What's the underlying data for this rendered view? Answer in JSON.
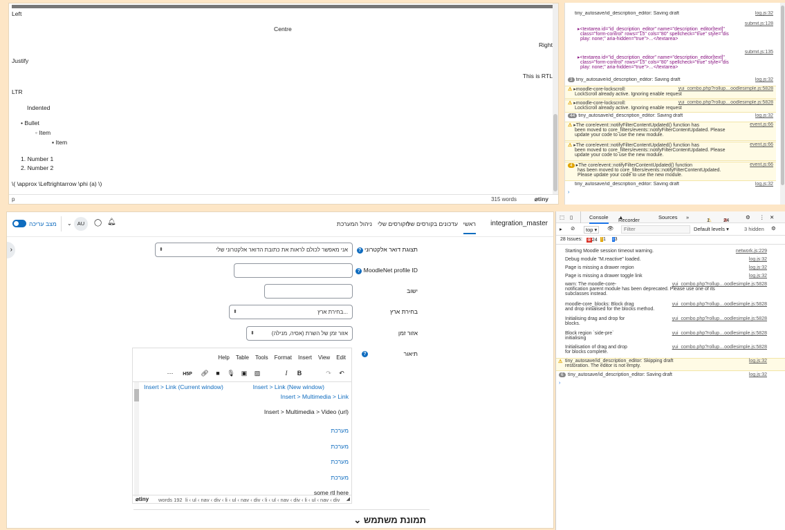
{
  "top_editor": {
    "lines": [
      "Left",
      "Centre",
      "Right",
      "Justify",
      "This is RTL",
      "LTR",
      "Indented",
      "Bullet",
      "Item",
      "Item",
      "Number 1",
      "Number 2",
      "\\( \\approx \\Leftrightarrow \\phi (a) \\)"
    ],
    "status_path": "p",
    "word_count": "315 words",
    "brand": "tiny"
  },
  "top_console": [
    {
      "msg": "tiny_autosave/id_description_editor: Saving draft",
      "src": "log.js:32"
    },
    {
      "msg": "<textarea id=\"id_description_editor\" name=\"description_editor[text]\"",
      "msg2": "class=\"form-control\" rows=\"15\" cols=\"80\" spellcheck=\"true\" style=\"dis",
      "msg3": "play: none;\" aria-hidden=\"true\">…</textarea>",
      "src": "submit.js:128"
    },
    {
      "msg": "<textarea id=\"id_description_editor\" name=\"description_editor[text]\"",
      "msg2": "class=\"form-control\" rows=\"15\" cols=\"80\" spellcheck=\"true\" style=\"dis",
      "msg3": "play: none;\" aria-hidden=\"true\">…</textarea>",
      "src": "submit.js:135"
    },
    {
      "count": "3",
      "msg": "tiny_autosave/id_description_editor: Saving draft",
      "src": "log.js:32"
    },
    {
      "msg": "moodle-core-lockscroll:",
      "msg2": "LockScroll already active. Ignoring enable request",
      "src": "yui_combo.php?rollup…oodlesimple.js:5828"
    },
    {
      "msg": "moodle-core-lockscroll:",
      "msg2": "LockScroll already active. Ignoring enable request",
      "src": "yui_combo.php?rollup…oodlesimple.js:5828"
    },
    {
      "count": "44",
      "msg": "tiny_autosave/id_description_editor: Saving draft",
      "src": "log.js:32"
    },
    {
      "msg": "The core/event::notifyFilterContentUpdated() function has",
      "msg2": "been moved to core_filters/events::notifyFilterContentUpdated. Please",
      "msg3": "update your code to use the new module.",
      "src": "event.js:66"
    },
    {
      "msg": "The core/event::notifyFilterContentUpdated() function has",
      "msg2": "been moved to core_filters/events::notifyFilterContentUpdated. Please",
      "msg3": "update your code to use the new module.",
      "src": "event.js:66"
    },
    {
      "count": "4",
      "msg": "The core/event::notifyFilterContentUpdated() function",
      "msg2": "has been moved to core_filters/events::notifyFilterContentUpdated.",
      "msg3": "Please update your code to use the new module.",
      "src": "event.js:66"
    },
    {
      "msg": "tiny_autosave/id_description_editor: Saving draft",
      "src": "log.js:32"
    }
  ],
  "page": {
    "site_name": "integration_master",
    "nav": [
      "ראשי",
      "עדכונים בקורסים שלי",
      "הקורסים שלי",
      "ניהול המערכת"
    ],
    "edit_mode": "מצב עריכה",
    "avatar": "AU",
    "fields": {
      "email_display_label": "תצוגת דואר אלקטרוני",
      "email_display_value": "אני מאפשר לכולם לראות את כתובת הדואר אלקטרוני שלי",
      "moodlenet_label": "MoodleNet profile ID",
      "city_label": "ישוב",
      "country_label": "בחירת ארץ",
      "country_value": "בחירת ארץ...",
      "timezone_label": "אזור זמן",
      "timezone_value": "אזור זמן של השרת (אסיה, מנילה)",
      "description_label": "תיאור"
    },
    "editor": {
      "menu": [
        "Edit",
        "View",
        "Insert",
        "Format",
        "Tools",
        "Table",
        "Help"
      ],
      "content": [
        "Insert > Link (Current window)",
        "Insert > Link (New window)",
        "Insert > Multimedia > Link",
        "Insert > Multimedia > Video (url)",
        "מערכת",
        "מערכת",
        "מערכת",
        "מערכת",
        "some rtl here"
      ],
      "words": "words 192",
      "path": "li ‹ ul ‹ nav ‹ div ‹ li ‹ ul ‹ nav ‹ div ‹ li ‹ ul ‹ nav ‹ div ‹ li ‹ ul ‹ nav ‹ div"
    },
    "section_heading": "תמונת משתמש"
  },
  "devtools": {
    "tabs": [
      "Console",
      "Recorder",
      "Sources"
    ],
    "warn_count": "1",
    "error_count": "24",
    "context": "top",
    "filter_placeholder": "Filter",
    "levels": "Default levels",
    "hidden": "3 hidden",
    "issues_label": "28 Issues:",
    "issues_err": "24",
    "issues_warn": "1",
    "issues_info": "3",
    "rows": [
      {
        "msg": "Starting Moodle session timeout warning.",
        "src": "network.js:229",
        "type": "log"
      },
      {
        "msg": "Debug module \"M.reactive\" loaded.",
        "src": "log.js:32",
        "type": "log"
      },
      {
        "msg": "Page is missing a drawer region",
        "src": "log.js:32",
        "type": "log"
      },
      {
        "msg": "Page is missing a drawer toggle link",
        "src": "log.js:32",
        "type": "log"
      },
      {
        "msg": "warn: The moodle-core-\nnotification parent module has been deprecated. Please use one of its\nsubclasses instead.",
        "src": "yui_combo.php?rollup…oodlesimple.js:5828",
        "type": "log"
      },
      {
        "msg": "moodle-core_blocks: Block drag\nand drop initialised for the blocks method.",
        "src": "yui_combo.php?rollup…oodlesimple.js:5828",
        "type": "log"
      },
      {
        "msg": "Initialising drag and drop for\nblocks.",
        "src": "yui_combo.php?rollup…oodlesimple.js:5828",
        "type": "log"
      },
      {
        "msg": "Block region `side-pre`\ninitialising",
        "src": "yui_combo.php?rollup…oodlesimple.js:5828",
        "type": "log"
      },
      {
        "msg": "Initialisation of drag and drop\nfor blocks complete.",
        "src": "yui_combo.php?rollup…oodlesimple.js:5828",
        "type": "log"
      },
      {
        "msg": "tiny_autosave/id_description_editor: Skipping draft\nrestoration. The editor is not empty.",
        "src": "log.js:32",
        "type": "warn"
      },
      {
        "msg": "tiny_autosave/id_description_editor: Saving draft",
        "src": "log.js:32",
        "type": "count",
        "count": "6"
      }
    ]
  }
}
